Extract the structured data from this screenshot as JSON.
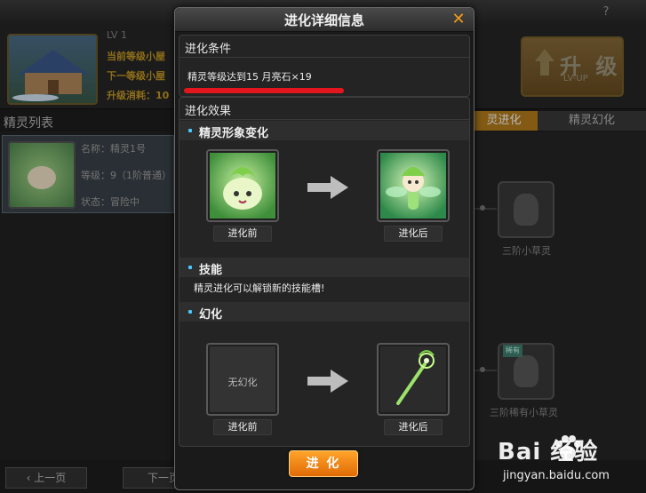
{
  "background": {
    "help_icon": "?",
    "level_tag": "LV 1",
    "current_level_line": "当前等级小屋",
    "next_level_line": "下一等级小屋",
    "upgrade_cost_line": "升级消耗：10",
    "upgrade_button": {
      "main": "升 级",
      "sub": "LV-UP"
    },
    "list_title": "精灵列表",
    "card": {
      "name": "名称：精灵1号",
      "level": "等级：9（1阶普通）",
      "status": "状态：冒险中"
    },
    "tabs": [
      "灵进化",
      "精灵幻化"
    ],
    "nodes": [
      {
        "label": "三阶小草灵"
      },
      {
        "label": "三阶稀有小草灵",
        "badge": "稀有"
      }
    ],
    "prev_page": "上一页",
    "next_page": "下一页"
  },
  "modal": {
    "title": "进化详细信息",
    "close_icon": "✕",
    "condition": {
      "title": "进化条件",
      "text": "精灵等级达到15   月亮石×19"
    },
    "effect": {
      "title": "进化效果",
      "appearance": {
        "title": "精灵形象变化",
        "before_label": "进化前",
        "after_label": "进化后"
      },
      "skill": {
        "title": "技能",
        "text": "精灵进化可以解锁新的技能槽!"
      },
      "morph": {
        "title": "幻化",
        "before_text": "无幻化",
        "before_label": "进化前",
        "after_label": "进化后"
      }
    },
    "evolve_button": "进 化"
  },
  "watermark": {
    "brand": "Bai  经验",
    "url": "jingyan.baidu.com"
  },
  "colors": {
    "accent_orange": "#f39a1a",
    "underline_red": "#e2161c",
    "bullet_blue": "#47c8ff"
  }
}
